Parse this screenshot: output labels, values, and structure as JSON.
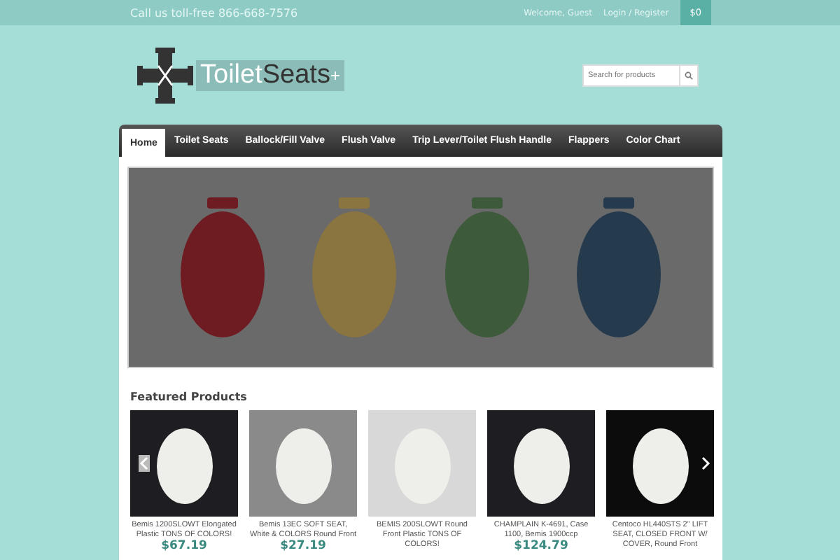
{
  "top_bar": {
    "phone": "Call us toll-free 866-668-7576",
    "welcome": "Welcome, Guest",
    "login": "Login / Register",
    "cart": "$0"
  },
  "logo": {
    "text_light": "Toilet",
    "text_dark": "Seats",
    "plus": "+"
  },
  "search": {
    "placeholder": "Search for products"
  },
  "nav": [
    {
      "label": "Home",
      "selected": true
    },
    {
      "label": "Toilet Seats",
      "selected": false
    },
    {
      "label": "Ballock/Fill Valve",
      "selected": false
    },
    {
      "label": "Flush Valve",
      "selected": false
    },
    {
      "label": "Trip Lever/Toilet Flush Handle",
      "selected": false
    },
    {
      "label": "Flappers",
      "selected": false
    },
    {
      "label": "Color Chart",
      "selected": false
    }
  ],
  "hero": {
    "seats": [
      {
        "color": "#6e1c22"
      },
      {
        "color": "#8a7440"
      },
      {
        "color": "#3d5a3a"
      },
      {
        "color": "#263a4e"
      }
    ]
  },
  "featured": {
    "title": "Featured Products",
    "products": [
      {
        "name": "Bemis 1200SLOWT Elongated Plastic TONS OF COLORS!",
        "price": "$67.19"
      },
      {
        "name": "Bemis 13EC SOFT SEAT, White & COLORS Round Front",
        "price": "$27.19"
      },
      {
        "name": "BEMIS 200SLOWT Round Front Plastic TONS OF COLORS!"
      },
      {
        "name": "CHAMPLAIN K-4691, Case 1100, Bemis 1900ccp",
        "price": "$124.79"
      },
      {
        "name": "Centoco HL440STS 2\" LIFT SEAT, CLOSED FRONT W/ COVER, Round Front"
      }
    ]
  }
}
